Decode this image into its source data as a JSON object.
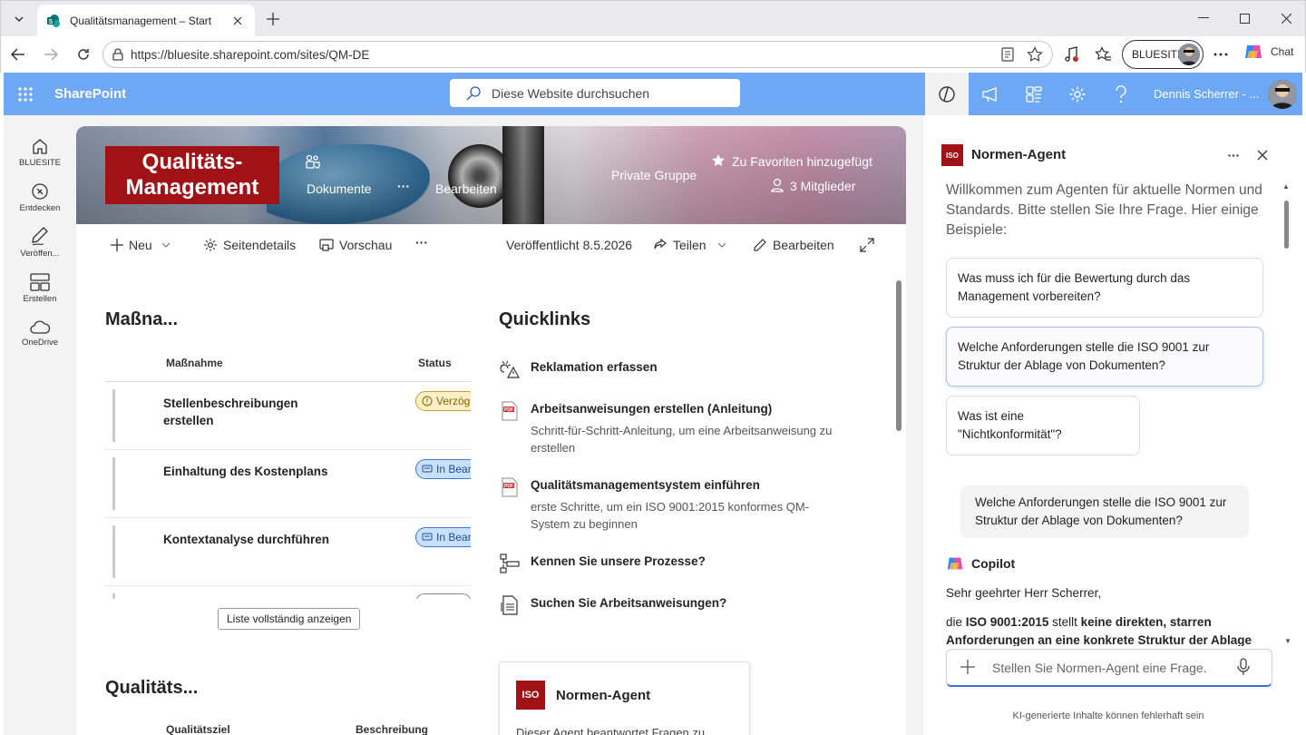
{
  "browser": {
    "tab_title": "Qualitätsmanagement – Start",
    "url": "https://bluesite.sharepoint.com/sites/QM-DE",
    "profile_label": "BLUESITE",
    "copilot_label": "Chat"
  },
  "suite": {
    "app_name": "SharePoint",
    "search_placeholder": "Diese Website durchsuchen",
    "user_name": "Dennis Scherrer - ..."
  },
  "rail": {
    "items": [
      {
        "label": "BLUESITE",
        "icon": "home-icon"
      },
      {
        "label": "Entdecken",
        "icon": "compass-icon"
      },
      {
        "label": "Veröffen...",
        "icon": "pen-icon"
      },
      {
        "label": "Erstellen",
        "icon": "layout-icon"
      },
      {
        "label": "OneDrive",
        "icon": "cloud-icon"
      }
    ]
  },
  "site": {
    "logo_line1": "Qualitäts-",
    "logo_line2": "Management",
    "nav_documents": "Dokumente",
    "nav_more": "···",
    "nav_edit": "Bearbeiten",
    "group_type": "Private Gruppe",
    "favorite_label": "Zu Favoriten hinzugefügt",
    "members_label": "3 Mitglieder"
  },
  "commandbar": {
    "new_label": "Neu",
    "page_details": "Seitendetails",
    "preview": "Vorschau",
    "more": "···",
    "published": "Veröffentlicht 8.5.2026",
    "share": "Teilen",
    "edit": "Bearbeiten"
  },
  "measures": {
    "title": "Maßna...",
    "col_measure": "Maßnahme",
    "col_status": "Status",
    "rows": [
      {
        "name": "Stellenbeschreibungen erstellen",
        "status": "Verzög",
        "status_type": "warn"
      },
      {
        "name": "Einhaltung des Kostenplans",
        "status": "In Bear",
        "status_type": "prog"
      },
      {
        "name": "Kontextanalyse durchführen",
        "status": "In Bear",
        "status_type": "prog"
      }
    ],
    "show_all": "Liste vollständig anzeigen"
  },
  "quicklinks": {
    "title": "Quicklinks",
    "items": [
      {
        "title": "Reklamation erfassen",
        "desc": "",
        "icon": "alert-person-icon"
      },
      {
        "title": "Arbeitsanweisungen erstellen (Anleitung)",
        "desc": "Schritt-für-Schritt-Anleitung, um eine Arbeitsanweisung zu erstellen",
        "icon": "pdf-icon"
      },
      {
        "title": "Qualitätsmanagementsystem einführen",
        "desc": "erste Schritte, um ein ISO 9001:2015 konformes QM-System zu beginnen",
        "icon": "pdf-icon"
      },
      {
        "title": "Kennen Sie unsere Prozesse?",
        "desc": "",
        "icon": "flowchart-icon"
      },
      {
        "title": "Suchen Sie Arbeitsanweisungen?",
        "desc": "",
        "icon": "document-list-icon"
      }
    ]
  },
  "agent_card": {
    "iso": "ISO",
    "title": "Normen-Agent",
    "desc": "Dieser Agent beantwortet Fragen zu"
  },
  "goals": {
    "title": "Qualitäts...",
    "col_goal": "Qualitätsziel",
    "col_desc": "Beschreibung"
  },
  "panel": {
    "iso": "ISO",
    "title": "Normen-Agent",
    "welcome": "Willkommen zum Agenten für aktuelle Normen und Standards. Bitte stellen Sie Ihre Frage. Hier einige Beispiele:",
    "suggestions": [
      "Was muss ich für die Bewertung durch das Management vorbereiten?",
      "Welche Anforderungen stelle die ISO 9001 zur Struktur der Ablage von Dokumenten?",
      "Was ist eine \"Nichtkonformität\"?"
    ],
    "user_message": "Welche Anforderungen stelle die ISO 9001 zur Struktur der Ablage von Dokumenten?",
    "copilot_name": "Copilot",
    "response_greeting": "Sehr geehrter Herr Scherrer,",
    "response_pre": "die ",
    "response_bold1": "ISO 9001:2015",
    "response_mid": " stellt ",
    "response_bold2": "keine direkten, starren Anforderungen an eine konkrete Struktur der Ablage",
    "input_placeholder": "Stellen Sie Normen-Agent eine Frage.",
    "disclaimer": "KI-generierte Inhalte können fehlerhaft sein"
  },
  "colors": {
    "suitebar": "#6ea7f4",
    "brand_red": "#a11216",
    "accent_blue": "#3c6fd8"
  }
}
